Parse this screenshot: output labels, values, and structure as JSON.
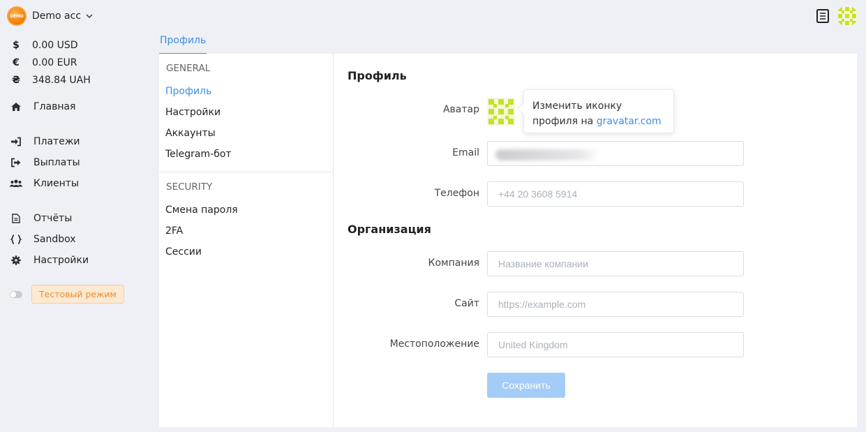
{
  "account": {
    "badge_text": "DEMO",
    "name": "Demo acc"
  },
  "balances": [
    {
      "symbol": "$",
      "amount": "0.00 USD"
    },
    {
      "symbol": "€",
      "amount": "0.00 EUR"
    },
    {
      "symbol": "₴",
      "amount": "348.84 UAH"
    }
  ],
  "nav": {
    "home": "Главная",
    "payments": "Платежи",
    "payouts": "Выплаты",
    "clients": "Клиенты",
    "reports": "Отчёты",
    "sandbox": "Sandbox",
    "settings": "Настройки"
  },
  "test_mode": {
    "label": "Тестовый режим",
    "enabled": false
  },
  "tabs": {
    "profile": "Профиль"
  },
  "settings_nav": {
    "general_heading": "GENERAL",
    "general_items": [
      "Профиль",
      "Настройки",
      "Аккаунты",
      "Telegram-бот"
    ],
    "security_heading": "SECURITY",
    "security_items": [
      "Смена пароля",
      "2FA",
      "Сессии"
    ]
  },
  "profile": {
    "title": "Профиль",
    "avatar_label": "Аватар",
    "tooltip_text": "Изменить иконку профиля на",
    "tooltip_link": "gravatar.com",
    "email_label": "Email",
    "phone_label": "Телефон",
    "phone_placeholder": "+44 20 3608 5914"
  },
  "organization": {
    "title": "Организация",
    "company_label": "Компания",
    "company_placeholder": "Название компании",
    "site_label": "Сайт",
    "site_placeholder": "https://example.com",
    "location_label": "Местоположение",
    "location_placeholder": "United Kingdom"
  },
  "save_label": "Сохранить",
  "colors": {
    "accent": "#3d8fe0",
    "save_disabled": "#a3cdf6",
    "test_badge_bg": "#fce9d2",
    "test_badge_text": "#e88f2e",
    "avatar_pattern": "#c8e02a"
  },
  "icons": {
    "demo": "demo-badge-icon",
    "chevron": "chevron-down-icon",
    "docs": "book-icon",
    "user": "identicon-avatar",
    "home": "home-icon",
    "payments": "sign-in-icon",
    "payouts": "sign-out-icon",
    "clients": "users-icon",
    "reports": "file-icon",
    "sandbox": "braces-icon",
    "settings": "gear-icon"
  }
}
